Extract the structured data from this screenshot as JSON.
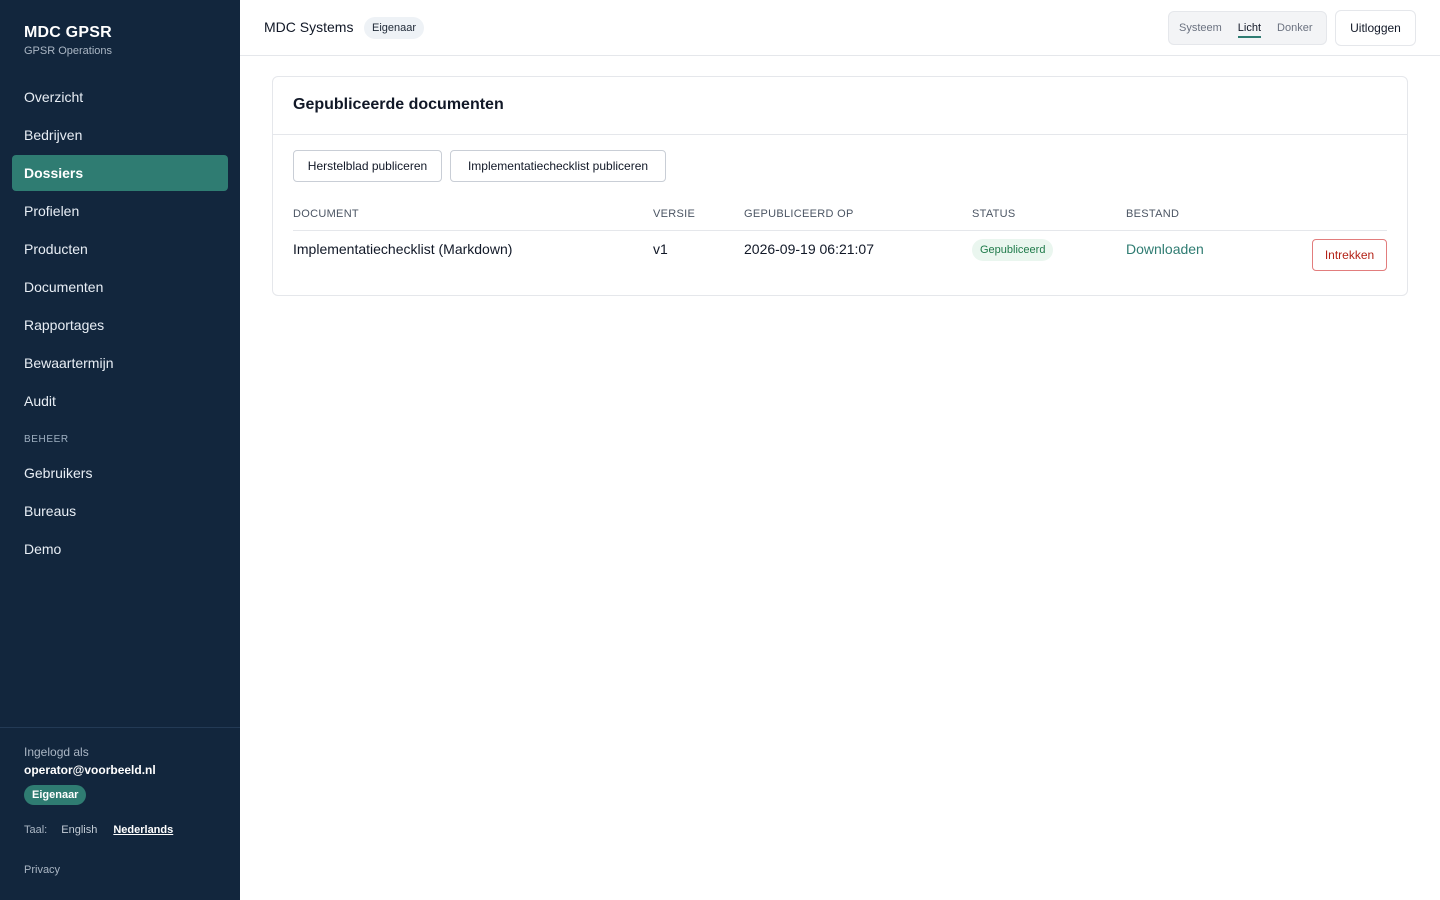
{
  "app": {
    "title": "MDC GPSR",
    "subtitle": "GPSR Operations"
  },
  "sidebar": {
    "items": [
      {
        "label": "Overzicht"
      },
      {
        "label": "Bedrijven"
      },
      {
        "label": "Dossiers",
        "active": true
      },
      {
        "label": "Profielen"
      },
      {
        "label": "Producten"
      },
      {
        "label": "Documenten"
      },
      {
        "label": "Rapportages"
      },
      {
        "label": "Bewaartermijn"
      },
      {
        "label": "Audit"
      }
    ],
    "admin_section": "BEHEER",
    "admin_items": [
      {
        "label": "Gebruikers"
      },
      {
        "label": "Bureaus"
      },
      {
        "label": "Demo"
      }
    ],
    "footer": {
      "logged_in_label": "Ingelogd als",
      "email": "operator@voorbeeld.nl",
      "role": "Eigenaar",
      "language_label": "Taal:",
      "languages": [
        "English",
        "Nederlands"
      ],
      "current_language": "Nederlands",
      "privacy": "Privacy"
    }
  },
  "topbar": {
    "org_name": "MDC Systems",
    "role_badge": "Eigenaar",
    "theme_options": [
      "Systeem",
      "Licht",
      "Donker"
    ],
    "theme_selected": "Licht",
    "logout": "Uitloggen"
  },
  "main": {
    "card_title": "Gepubliceerde documenten",
    "actions": {
      "publish_repair": "Herstelblad publiceren",
      "publish_checklist": "Implementatiechecklist publiceren"
    },
    "table": {
      "headers": {
        "document": "DOCUMENT",
        "version": "VERSIE",
        "published_at": "GEPUBLICEERD OP",
        "status": "STATUS",
        "file": "BESTAND"
      },
      "rows": [
        {
          "document": "Implementatiechecklist (Markdown)",
          "version": "v1",
          "published_at": "2026-09-19 06:21:07",
          "status": "Gepubliceerd",
          "file": "Downloaden",
          "action": "Intrekken"
        }
      ]
    }
  },
  "colors": {
    "sidebar_bg": "#12263d",
    "accent": "#2f7c72",
    "status_published_bg": "#eaf6ef",
    "status_published_text": "#1f7a4a",
    "danger": "#b42318"
  }
}
